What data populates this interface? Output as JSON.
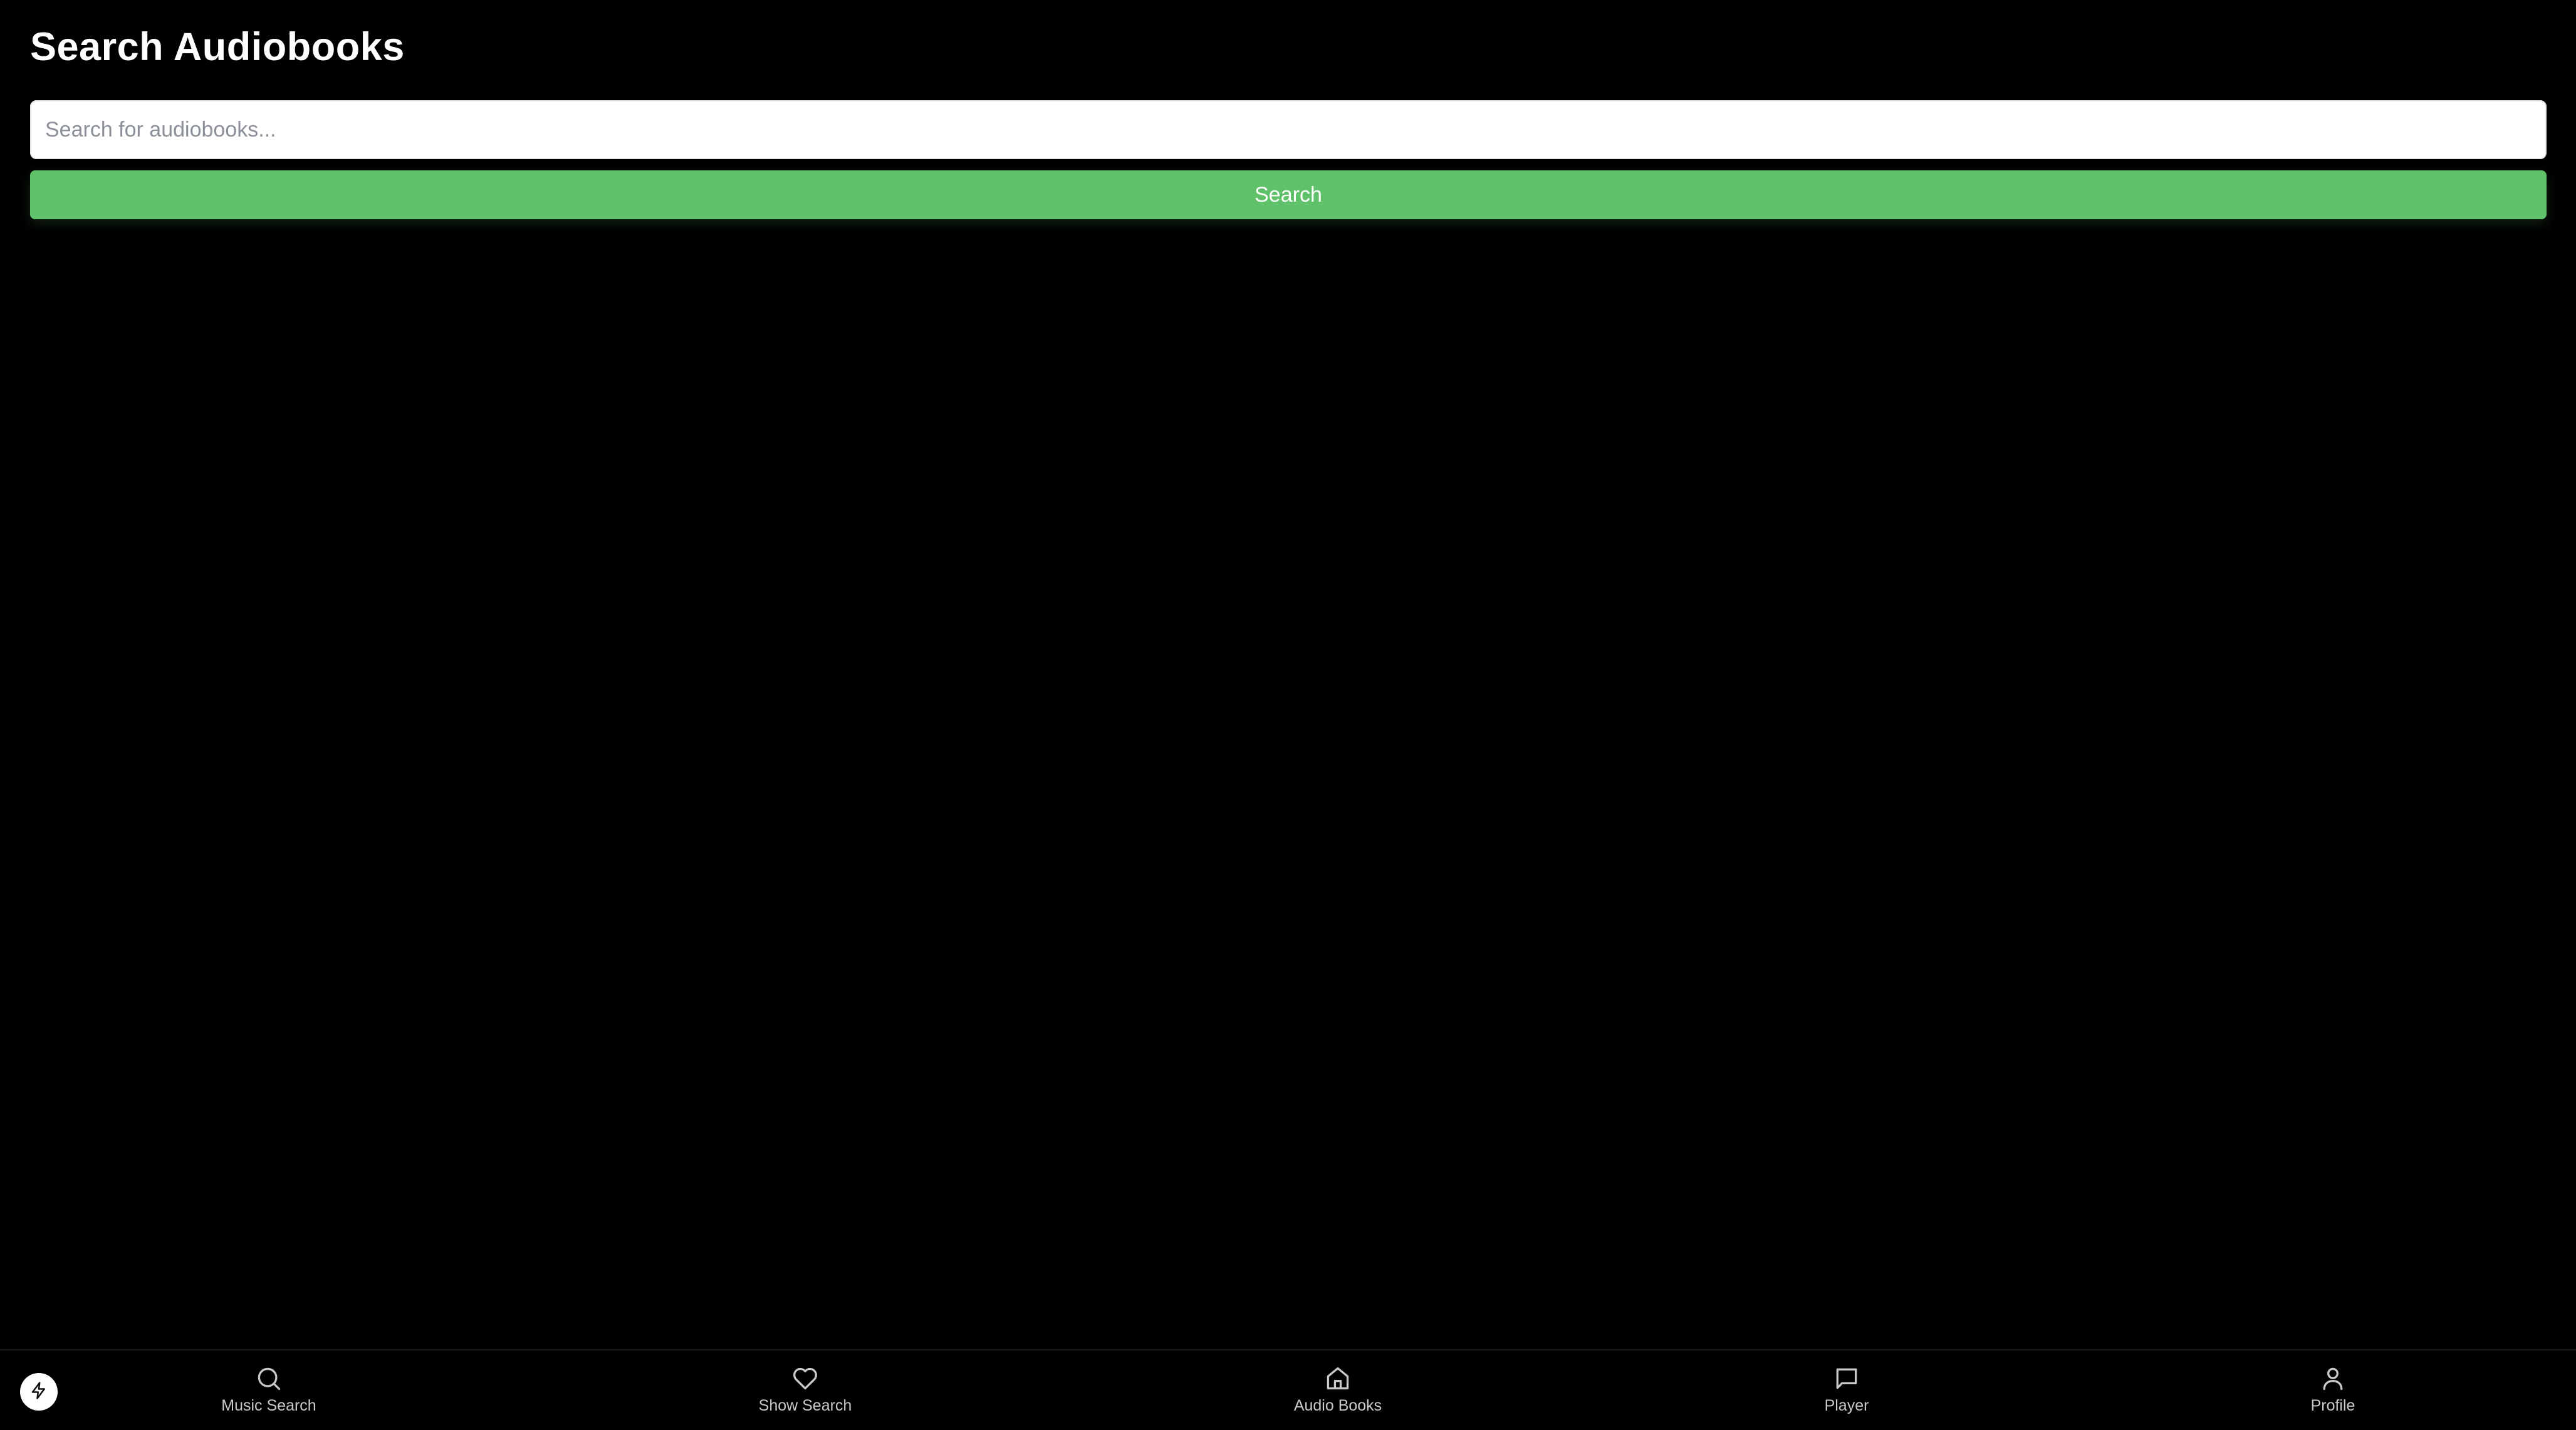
{
  "header": {
    "title": "Search Audiobooks"
  },
  "search": {
    "placeholder": "Search for audiobooks...",
    "value": "",
    "button_label": "Search"
  },
  "colors": {
    "background": "#000000",
    "accent": "#5fc16a",
    "nav_label": "#c8c8c8"
  },
  "bottom_nav": {
    "fab_icon": "bolt-icon",
    "items": [
      {
        "label": "Music Search",
        "icon": "search-icon"
      },
      {
        "label": "Show Search",
        "icon": "heart-icon"
      },
      {
        "label": "Audio Books",
        "icon": "home-icon"
      },
      {
        "label": "Player",
        "icon": "message-icon"
      },
      {
        "label": "Profile",
        "icon": "user-icon"
      }
    ]
  }
}
